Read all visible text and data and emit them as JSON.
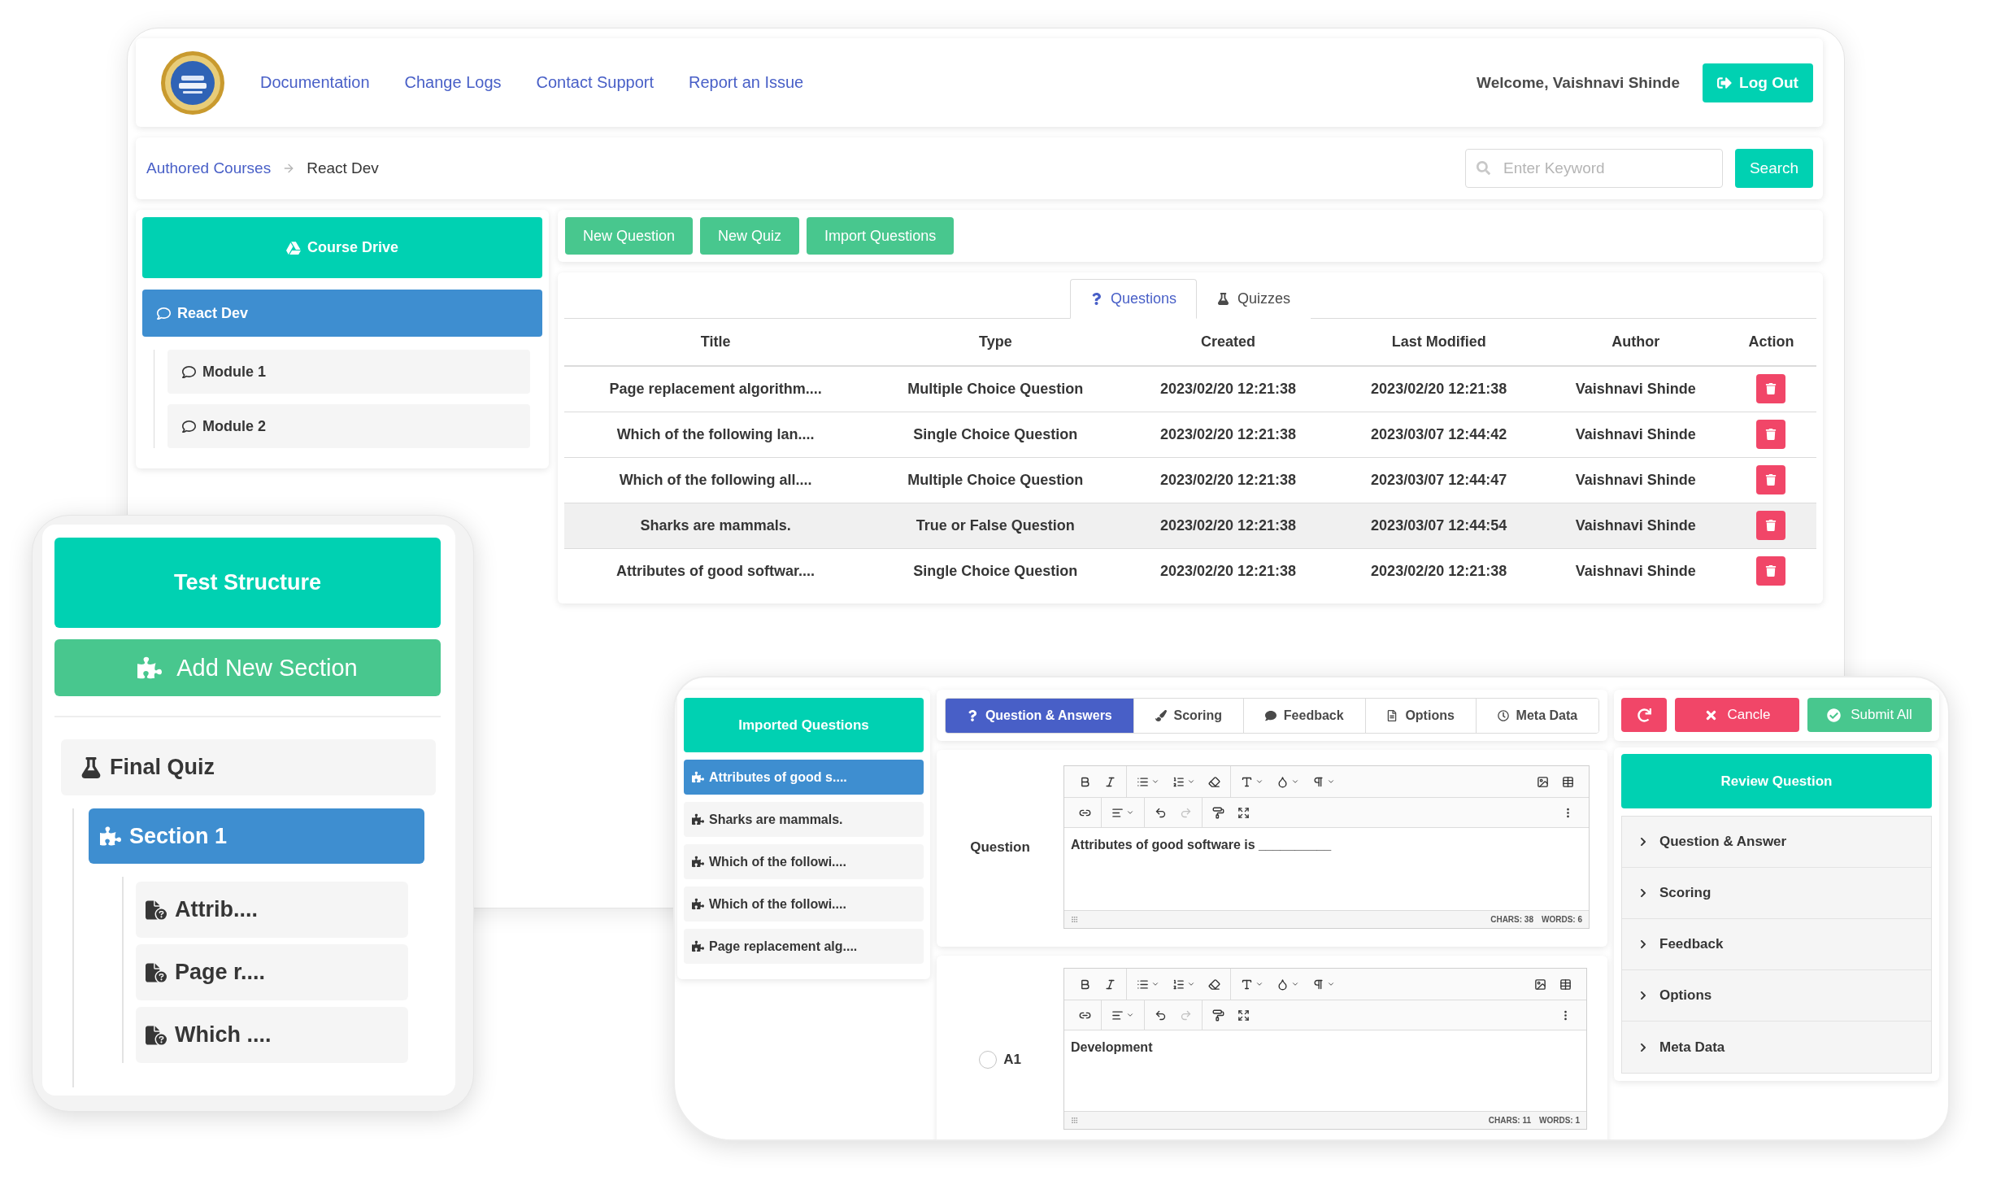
{
  "app_window": {
    "header": {
      "nav_links": [
        "Documentation",
        "Change Logs",
        "Contact Support",
        "Report an Issue"
      ],
      "welcome": "Welcome, Vaishnavi Shinde",
      "logout_button": "Log Out"
    },
    "breadcrumb": [
      {
        "label": "Authored Courses",
        "kind": "link"
      },
      {
        "label": "React Dev",
        "kind": "current"
      }
    ],
    "search": {
      "placeholder": "Enter Keyword",
      "button": "Search"
    },
    "sidebar": {
      "drive_button": "Course Drive",
      "tree": [
        {
          "label": "React Dev",
          "selected": true,
          "children": [
            {
              "label": "Module 1",
              "selected": false
            },
            {
              "label": "Module 2",
              "selected": false
            }
          ]
        }
      ]
    },
    "toolbar_buttons": [
      "New Question",
      "New Quiz",
      "Import Questions"
    ],
    "tabs": [
      {
        "label": "Questions",
        "kind": "questions",
        "selected": true
      },
      {
        "label": "Quizzes",
        "kind": "quizzes",
        "selected": false
      }
    ],
    "table": {
      "columns": [
        "Title",
        "Type",
        "Created",
        "Last Modified",
        "Author",
        "Action"
      ],
      "rows": [
        {
          "cells": [
            "Page replacement algorithm....",
            "Multiple Choice Question",
            "2023/02/20 12:21:38",
            "2023/02/20 12:21:38",
            "Vaishnavi Shinde"
          ],
          "highlighted": false
        },
        {
          "cells": [
            "Which of the following lan....",
            "Single Choice Question",
            "2023/02/20 12:21:38",
            "2023/03/07 12:44:42",
            "Vaishnavi Shinde"
          ],
          "highlighted": false
        },
        {
          "cells": [
            "Which of the following all....",
            "Multiple Choice Question",
            "2023/02/20 12:21:38",
            "2023/03/07 12:44:47",
            "Vaishnavi Shinde"
          ],
          "highlighted": false
        },
        {
          "cells": [
            "Sharks are mammals.",
            "True or False Question",
            "2023/02/20 12:21:38",
            "2023/03/07 12:44:54",
            "Vaishnavi Shinde"
          ],
          "highlighted": true
        },
        {
          "cells": [
            "Attributes of good softwar....",
            "Single Choice Question",
            "2023/02/20 12:21:38",
            "2023/02/20 12:21:38",
            "Vaishnavi Shinde"
          ],
          "highlighted": false
        }
      ]
    }
  },
  "structure_window": {
    "title": "Test Structure",
    "add_button": "Add New Section",
    "tree": [
      {
        "label": "Final Quiz",
        "kind": "quiz",
        "selected": false,
        "children": [
          {
            "label": "Section 1",
            "kind": "section",
            "selected": true,
            "children": [
              {
                "label": "Attrib....",
                "kind": "question",
                "selected": false
              },
              {
                "label": "Page r....",
                "kind": "question",
                "selected": false
              },
              {
                "label": "Which ....",
                "kind": "question",
                "selected": false
              }
            ]
          }
        ]
      }
    ]
  },
  "editor_window": {
    "imported": {
      "title": "Imported Questions",
      "items": [
        {
          "label": "Attributes of good s....",
          "selected": true
        },
        {
          "label": "Sharks are mammals.",
          "selected": false
        },
        {
          "label": "Which of the followi....",
          "selected": false
        },
        {
          "label": "Which of the followi....",
          "selected": false
        },
        {
          "label": "Page replacement alg....",
          "selected": false
        }
      ]
    },
    "tabs": [
      {
        "label": "Question & Answers",
        "kind": "question",
        "selected": true
      },
      {
        "label": "Scoring",
        "kind": "scoring",
        "selected": false
      },
      {
        "label": "Feedback",
        "kind": "feedback",
        "selected": false
      },
      {
        "label": "Options",
        "kind": "options",
        "selected": false
      },
      {
        "label": "Meta Data",
        "kind": "meta",
        "selected": false
      }
    ],
    "question": {
      "label": "Question",
      "text": "Attributes of good software is __________",
      "chars": "CHARS: 38",
      "words": "WORDS: 6",
      "redo_enabled": false
    },
    "answers": [
      {
        "label": "A1",
        "checked": false,
        "text": "Development",
        "chars": "CHARS: 11",
        "words": "WORDS: 1",
        "redo_enabled": false
      }
    ],
    "actions": [
      {
        "kind": "reset"
      },
      {
        "kind": "cancel",
        "label": "Cancle"
      },
      {
        "kind": "submit",
        "label": "Submit All"
      }
    ],
    "review": {
      "title": "Review Question",
      "sections": [
        {
          "label": "Question & Answer",
          "expanded": false
        },
        {
          "label": "Scoring",
          "expanded": false
        },
        {
          "label": "Feedback",
          "expanded": false
        },
        {
          "label": "Options",
          "expanded": false
        },
        {
          "label": "Meta Data",
          "expanded": false
        }
      ]
    }
  }
}
